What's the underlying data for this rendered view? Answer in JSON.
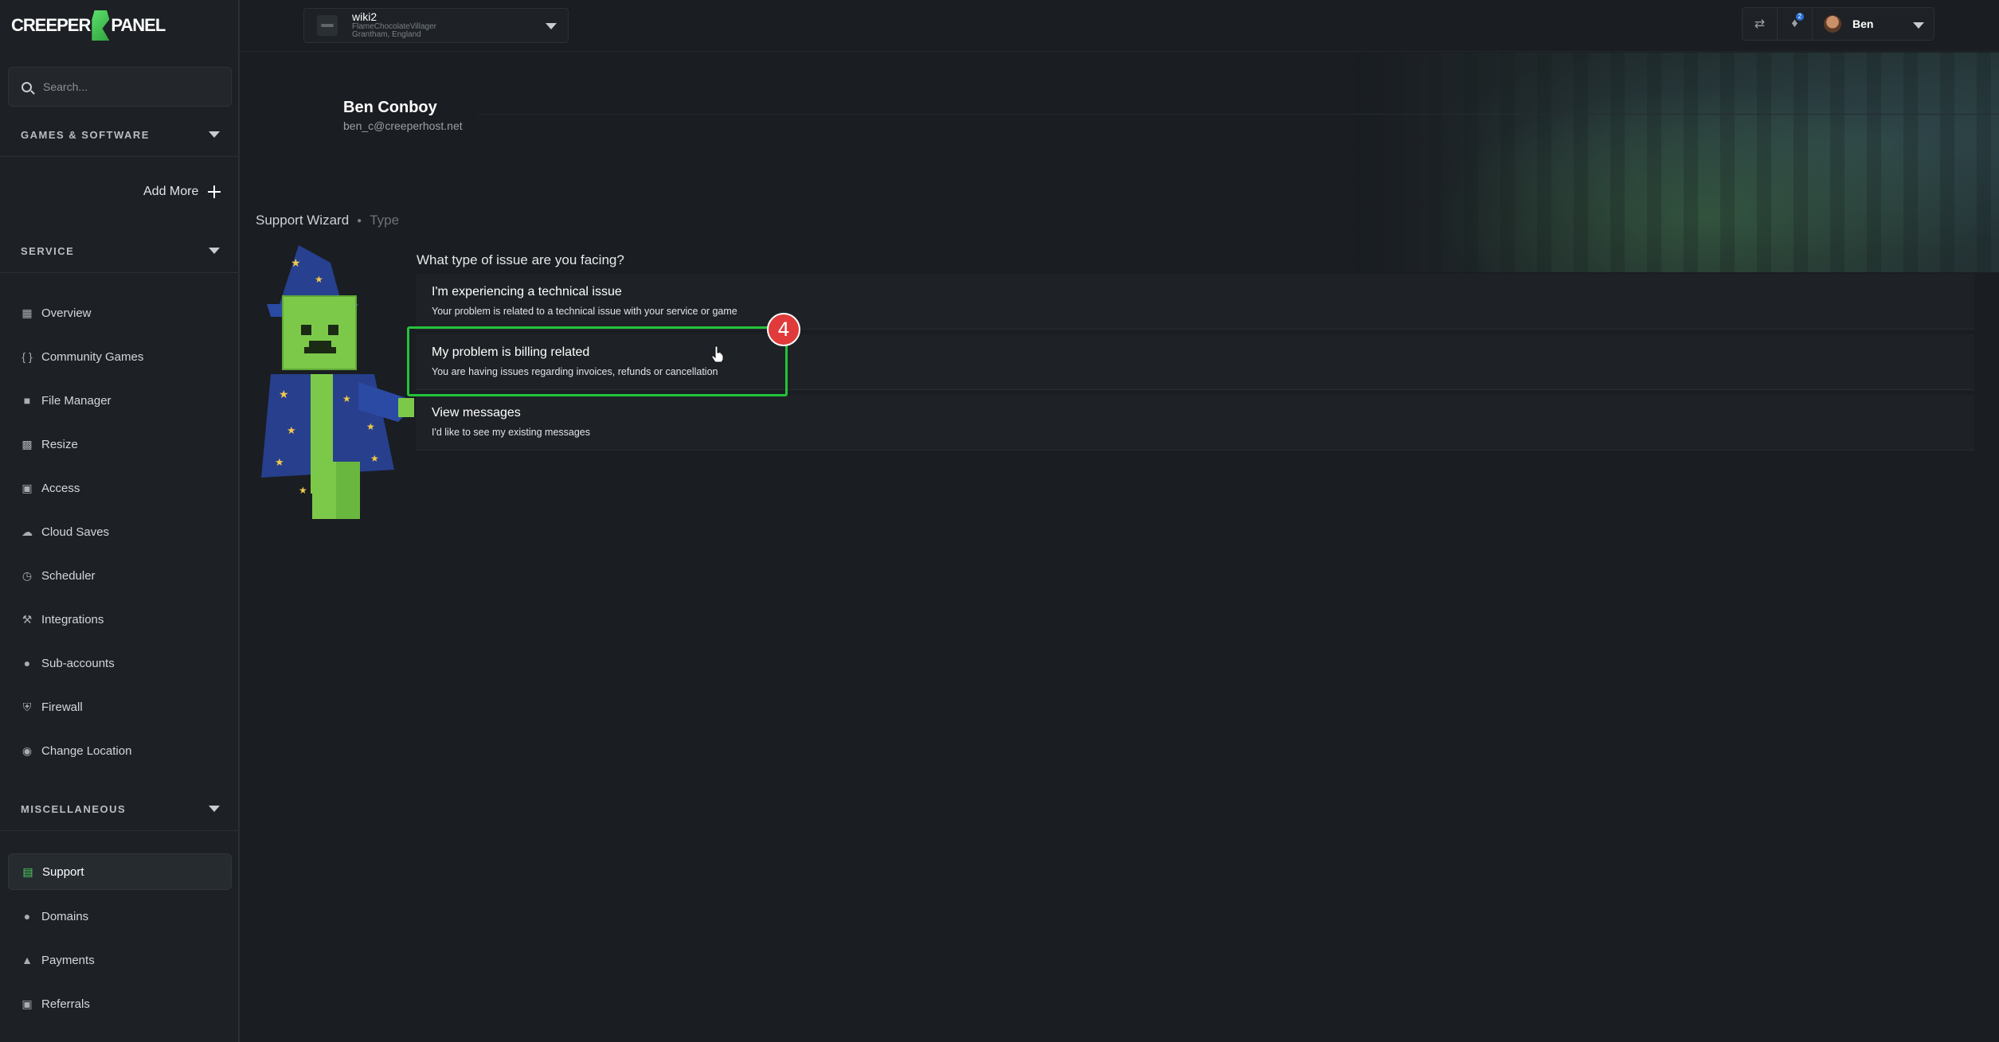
{
  "brand": {
    "left": "CREEPER",
    "right": "PANEL"
  },
  "search": {
    "placeholder": "Search..."
  },
  "sections": {
    "games": "GAMES & SOFTWARE",
    "add_more": "Add More",
    "service": "SERVICE",
    "misc": "MISCELLANEOUS"
  },
  "service_items": [
    {
      "label": "Overview",
      "icon": "grid-icon"
    },
    {
      "label": "Community Games",
      "icon": "braces-icon"
    },
    {
      "label": "File Manager",
      "icon": "folder-icon"
    },
    {
      "label": "Resize",
      "icon": "resize-icon"
    },
    {
      "label": "Access",
      "icon": "lock-icon"
    },
    {
      "label": "Cloud Saves",
      "icon": "cloud-icon"
    },
    {
      "label": "Scheduler",
      "icon": "clock-icon"
    },
    {
      "label": "Integrations",
      "icon": "wrench-icon"
    },
    {
      "label": "Sub-accounts",
      "icon": "users-icon"
    },
    {
      "label": "Firewall",
      "icon": "shield-icon"
    },
    {
      "label": "Change Location",
      "icon": "location-pin-icon"
    }
  ],
  "misc_items": [
    {
      "label": "Support",
      "icon": "support-icon",
      "active": true
    },
    {
      "label": "Domains",
      "icon": "globe-icon"
    },
    {
      "label": "Payments",
      "icon": "piggy-bank-icon"
    },
    {
      "label": "Referrals",
      "icon": "gift-icon"
    }
  ],
  "server": {
    "name": "wiki2",
    "owner": "FlameChocolateVillager",
    "location": "Grantham, England"
  },
  "header": {
    "notification_count": "2",
    "user": "Ben"
  },
  "profile": {
    "name": "Ben Conboy",
    "email": "ben_c@creeperhost.net"
  },
  "breadcrumb": {
    "root": "Support Wizard",
    "current": "Type"
  },
  "wizard": {
    "question": "What type of issue are you facing?",
    "options": [
      {
        "title": "I'm experiencing a technical issue",
        "desc": "Your problem is related to a technical issue with your service or game"
      },
      {
        "title": "My problem is billing related",
        "desc": "You are having issues regarding invoices, refunds or cancellation"
      },
      {
        "title": "View messages",
        "desc": "I'd like to see my existing messages"
      }
    ]
  },
  "annotation": {
    "step": "4",
    "highlight_color": "#24c23a",
    "badge_color": "#e03a3a"
  }
}
